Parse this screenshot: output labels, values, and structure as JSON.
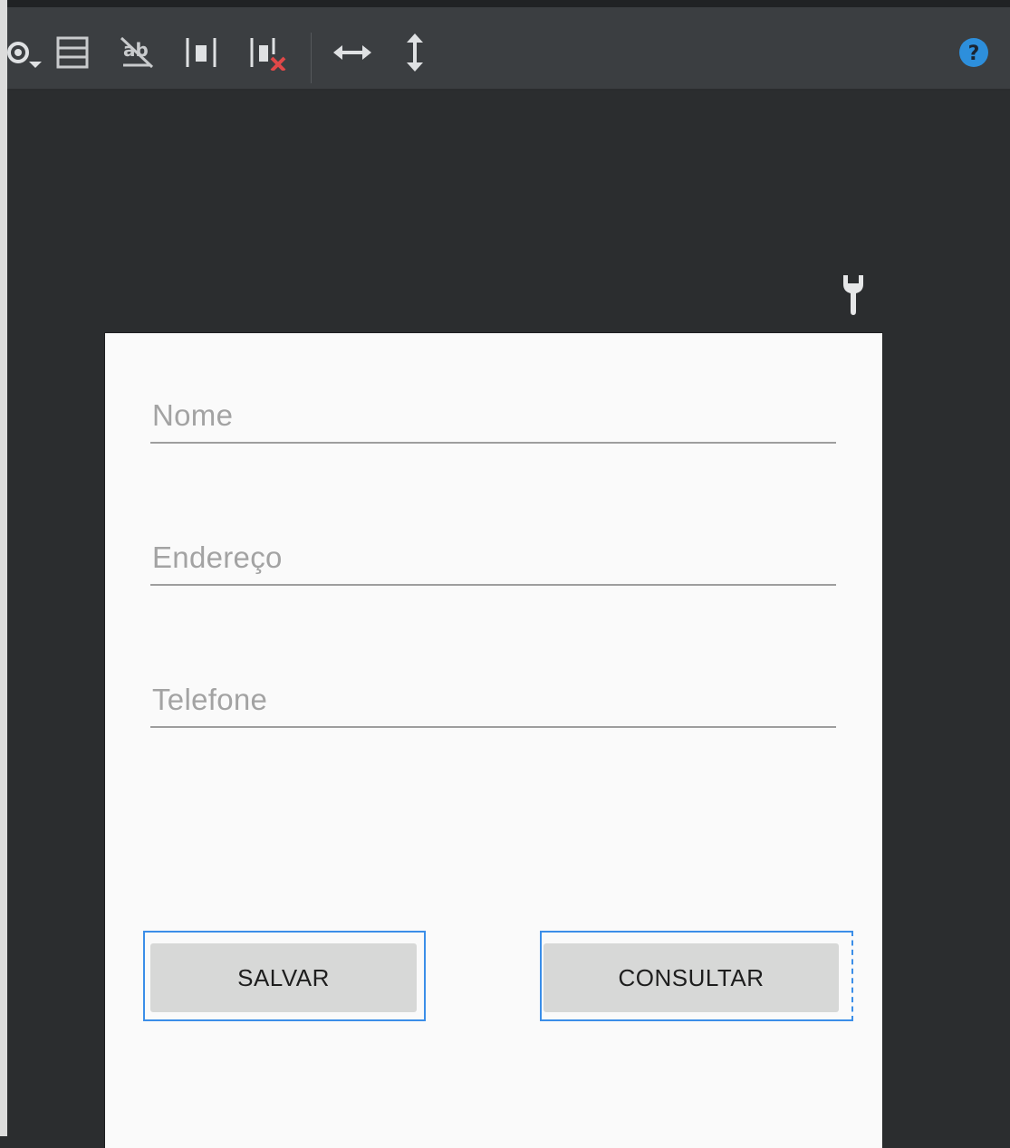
{
  "toolbar": {
    "icons": [
      "eye-dropdown-icon",
      "layout-list-icon",
      "text-off-icon",
      "pack-icon",
      "clear-constraints-icon",
      "expand-horizontal-icon",
      "expand-vertical-icon",
      "help-icon"
    ]
  },
  "canvas": {
    "action_icon": "wrench-icon"
  },
  "form": {
    "fields": [
      {
        "hint": "Nome"
      },
      {
        "hint": "Endereço"
      },
      {
        "hint": "Telefone"
      }
    ],
    "buttons": {
      "save_label": "SALVAR",
      "query_label": "CONSULTAR"
    }
  },
  "colors": {
    "selection": "#3b8ee8",
    "help": "#2d8fdc",
    "error": "#e04848"
  }
}
